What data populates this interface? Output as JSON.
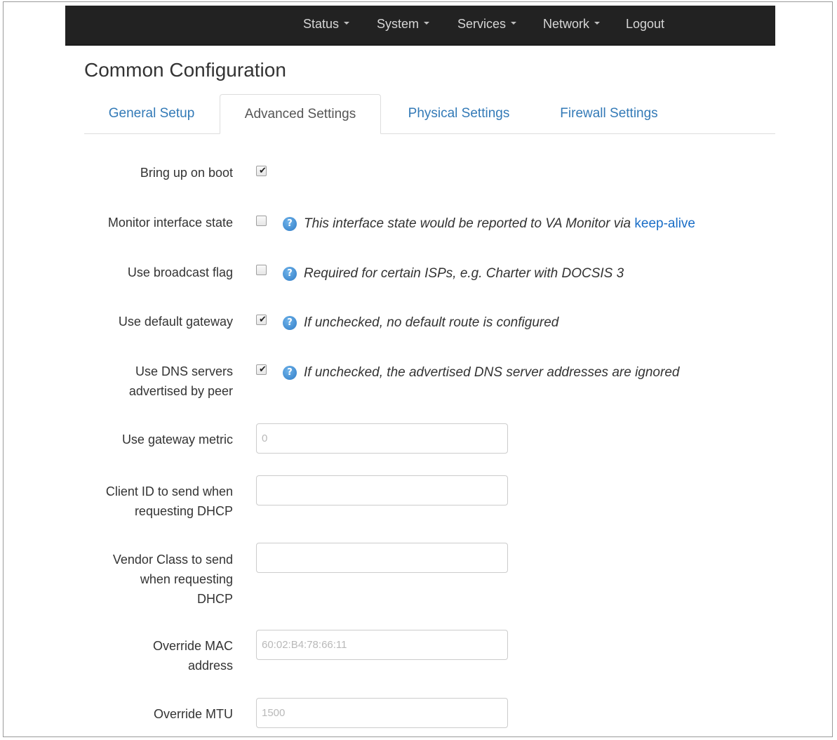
{
  "navbar": {
    "items": [
      {
        "label": "Status",
        "dropdown": true
      },
      {
        "label": "System",
        "dropdown": true
      },
      {
        "label": "Services",
        "dropdown": true
      },
      {
        "label": "Network",
        "dropdown": true
      },
      {
        "label": "Logout",
        "dropdown": false
      }
    ]
  },
  "page": {
    "title": "Common Configuration"
  },
  "tabs": [
    {
      "label": "General Setup",
      "active": false
    },
    {
      "label": "Advanced Settings",
      "active": true
    },
    {
      "label": "Physical Settings",
      "active": false
    },
    {
      "label": "Firewall Settings",
      "active": false
    }
  ],
  "form": {
    "bring_up_on_boot": {
      "label": "Bring up on boot",
      "checked": true
    },
    "monitor_interface_state": {
      "label": "Monitor interface state",
      "checked": false,
      "help": "This interface state would be reported to VA Monitor via",
      "help_link": "keep-alive"
    },
    "use_broadcast_flag": {
      "label": "Use broadcast flag",
      "checked": false,
      "help": "Required for certain ISPs, e.g. Charter with DOCSIS 3"
    },
    "use_default_gateway": {
      "label": "Use default gateway",
      "checked": true,
      "help": "If unchecked, no default route is configured"
    },
    "use_dns_servers": {
      "label_line1": "Use DNS servers",
      "label_line2": "advertised by peer",
      "checked": true,
      "help": "If unchecked, the advertised DNS server addresses are ignored"
    },
    "gateway_metric": {
      "label": "Use gateway metric",
      "value": "",
      "placeholder": "0"
    },
    "client_id": {
      "label_line1": "Client ID to send when",
      "label_line2": "requesting DHCP",
      "value": "",
      "placeholder": ""
    },
    "vendor_class": {
      "label_line1": "Vendor Class to send",
      "label_line2": "when requesting",
      "label_line3": "DHCP",
      "value": "",
      "placeholder": ""
    },
    "override_mac": {
      "label_line1": "Override MAC",
      "label_line2": "address",
      "value": "",
      "placeholder": "60:02:B4:78:66:11"
    },
    "override_mtu": {
      "label": "Override MTU",
      "value": "",
      "placeholder": "1500"
    }
  },
  "icons": {
    "help": "question-mark-circle-icon",
    "help_glyph": "?",
    "check_glyph": "✔"
  },
  "colors": {
    "navbar_bg": "#222222",
    "link": "#337ab7",
    "help_icon": "#3a87d4"
  }
}
